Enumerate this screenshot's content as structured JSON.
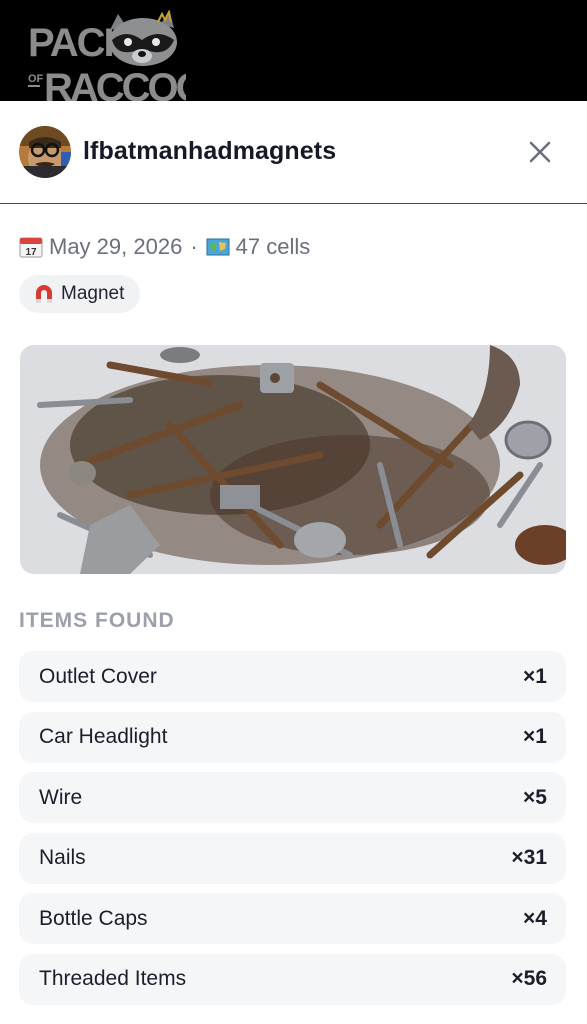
{
  "brand": {
    "line1": "PACK",
    "line2_small": "OF",
    "line2": "RACCOONS"
  },
  "header": {
    "username": "lfbatmanhadmagnets"
  },
  "meta": {
    "calendar_icon": "calendar-icon",
    "date": "May 29, 2026",
    "separator": "·",
    "map_icon": "map-icon",
    "cells": "47 cells"
  },
  "tag": {
    "icon": "magnet-icon",
    "label": "Magnet"
  },
  "section": {
    "title": "ITEMS FOUND"
  },
  "items": [
    {
      "name": "Outlet Cover",
      "qty": "×1"
    },
    {
      "name": "Car Headlight",
      "qty": "×1"
    },
    {
      "name": "Wire",
      "qty": "×5"
    },
    {
      "name": "Nails",
      "qty": "×31"
    },
    {
      "name": "Bottle Caps",
      "qty": "×4"
    },
    {
      "name": "Threaded Items",
      "qty": "×56"
    }
  ],
  "colors": {
    "topbar": "#000000",
    "logo_text": "#8a8c8e",
    "accent_gold": "#c9a227",
    "magnet_red": "#d63c32"
  }
}
